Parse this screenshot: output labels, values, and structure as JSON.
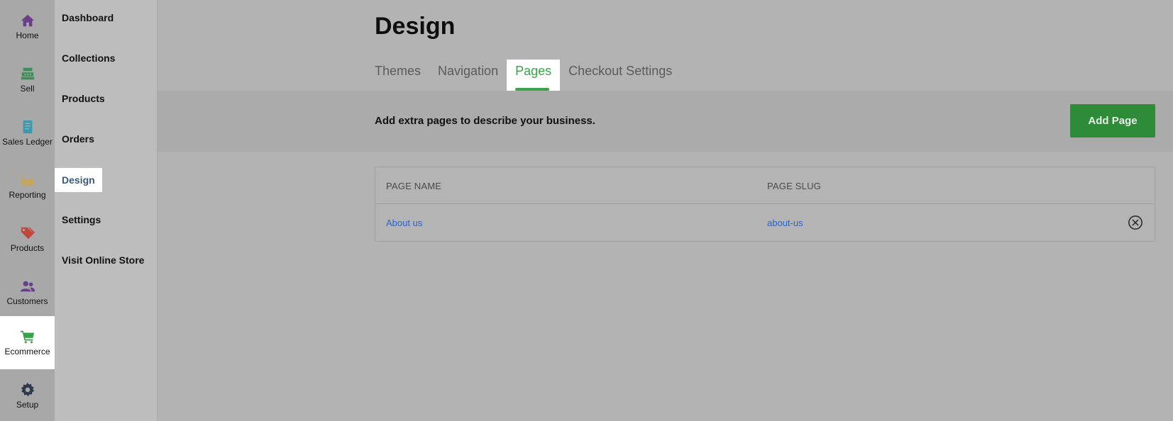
{
  "rail": {
    "items": [
      {
        "label": "Home",
        "icon": "home-icon",
        "color": "#6b3d8c"
      },
      {
        "label": "Sell",
        "icon": "register-icon",
        "color": "#3c8f57"
      },
      {
        "label": "Sales Ledger",
        "icon": "ledger-icon",
        "color": "#3a9bb0"
      },
      {
        "label": "Reporting",
        "icon": "chart-area-icon",
        "color": "#c9a356"
      },
      {
        "label": "Products",
        "icon": "tags-icon",
        "color": "#c2463b"
      },
      {
        "label": "Customers",
        "icon": "users-icon",
        "color": "#6b3d8c"
      },
      {
        "label": "Ecommerce",
        "icon": "cart-icon",
        "color": "#3aa34a",
        "active": true
      },
      {
        "label": "Setup",
        "icon": "gear-icon",
        "color": "#2d3a4d"
      }
    ]
  },
  "subnav": {
    "items": [
      {
        "label": "Dashboard"
      },
      {
        "label": "Collections"
      },
      {
        "label": "Products"
      },
      {
        "label": "Orders"
      },
      {
        "label": "Design",
        "active": true
      },
      {
        "label": "Settings"
      },
      {
        "label": "Visit Online Store"
      }
    ]
  },
  "main": {
    "title": "Design",
    "tabs": [
      {
        "label": "Themes"
      },
      {
        "label": "Navigation"
      },
      {
        "label": "Pages",
        "active": true
      },
      {
        "label": "Checkout Settings"
      }
    ],
    "description": "Add extra pages to describe your business.",
    "add_button": "Add Page",
    "table": {
      "headers": [
        "PAGE NAME",
        "PAGE SLUG"
      ],
      "rows": [
        {
          "name": "About us",
          "slug": "about-us"
        }
      ]
    }
  },
  "colors": {
    "accent_green": "#3aa34a",
    "button_green": "#2e8b37",
    "link_blue": "#2a63c7"
  }
}
